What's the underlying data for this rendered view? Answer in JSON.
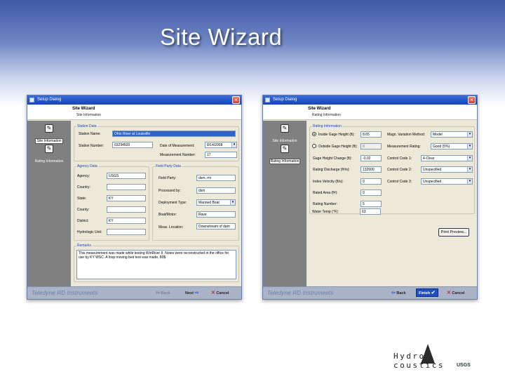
{
  "slide": {
    "title": "Site Wizard"
  },
  "left": {
    "window_title": "Setup Dialog",
    "header_title": "Site Wizard",
    "header_subtitle": "Site Information",
    "nav": [
      {
        "label": "Site Information",
        "icon": "wizard-icon",
        "active": true
      },
      {
        "label": "Rating Information",
        "icon": "wizard-icon",
        "active": false
      }
    ],
    "station_data": {
      "legend": "Station Data",
      "station_name_label": "Station Name:",
      "station_name_value": "Ohio River at Louisville",
      "station_number_label": "Station Number:",
      "station_number_value": "03294500",
      "date_label": "Date of Measurement:",
      "date_value": "8/14/2008",
      "measurement_number_label": "Measurement Number:",
      "measurement_number_value": "17"
    },
    "agency_data": {
      "legend": "Agency Data",
      "agency_label": "Agency:",
      "agency_value": "USGS",
      "country_label": "Country:",
      "country_value": "",
      "state_label": "State:",
      "state_value": "KY",
      "county_label": "County:",
      "county_value": "",
      "district_label": "District:",
      "district_value": "KY",
      "huc_label": "Hydrologic Unit:",
      "huc_value": ""
    },
    "field_party": {
      "legend": "Field Party Data",
      "field_party_label": "Field Party:",
      "field_party_value": "dsm, rnr",
      "processed_by_label": "Processed by:",
      "processed_by_value": "dsm",
      "deployment_label": "Deployment Type:",
      "deployment_value": "Manned Boat",
      "boat_label": "Boat/Motor:",
      "boat_value": "Rave",
      "location_label": "Meas. Location:",
      "location_value": "Downstream of dam"
    },
    "remarks": {
      "legend": "Remarks",
      "text": "This measurement was made while testing WinRiver II. Notes were reconstructed in the office for use by KY WSC. A loop moving bed test was made, 80$"
    },
    "footer": {
      "brand": "Teledyne RD Instruments",
      "back": "Back",
      "next": "Next",
      "cancel": "Cancel"
    }
  },
  "right": {
    "window_title": "Setup Dialog",
    "header_title": "Site Wizard",
    "header_subtitle": "Rating Information",
    "nav": [
      {
        "label": "Site Information",
        "icon": "wizard-icon",
        "active": false
      },
      {
        "label": "Rating Information",
        "icon": "wizard-icon",
        "active": true
      }
    ],
    "rating": {
      "legend": "Rating Information",
      "inside_label": "Inside Gage Height (ft):",
      "inside_value": "8.65",
      "inside_checked": true,
      "outside_label": "Outside Gage Height (ft):",
      "outside_value": "0",
      "outside_checked": false,
      "gage_change_label": "Gage Height Change (ft):",
      "gage_change_value": "-0.02",
      "rating_discharge_label": "Rating Discharge (ft³/s):",
      "rating_discharge_value": "132600",
      "index_velocity_label": "Index Velocity (ft/s):",
      "index_velocity_value": "0",
      "rated_area_label": "Rated Area (ft²):",
      "rated_area_value": "0",
      "rating_number_label": "Rating Number:",
      "rating_number_value": "5",
      "water_temp_label": "Water Temp (°F):",
      "water_temp_value": "63",
      "mag_method_label": "Magn. Variation Method:",
      "mag_method_value": "Model",
      "meas_rating_label": "Measurement Rating:",
      "meas_rating_value": "Good (5%)",
      "cc1_label": "Control Code 1:",
      "cc1_value": "4-Clear",
      "cc2_label": "Control Code 2:",
      "cc2_value": "Unspecified",
      "cc3_label": "Control Code 3:",
      "cc3_value": "Unspecified",
      "print_preview": "Print Preview..."
    },
    "footer": {
      "brand": "Teledyne RD Instruments",
      "back": "Back",
      "finish": "Finish",
      "cancel": "Cancel"
    }
  },
  "logo": {
    "word": "Hydro coustics",
    "agency": "USGS"
  }
}
